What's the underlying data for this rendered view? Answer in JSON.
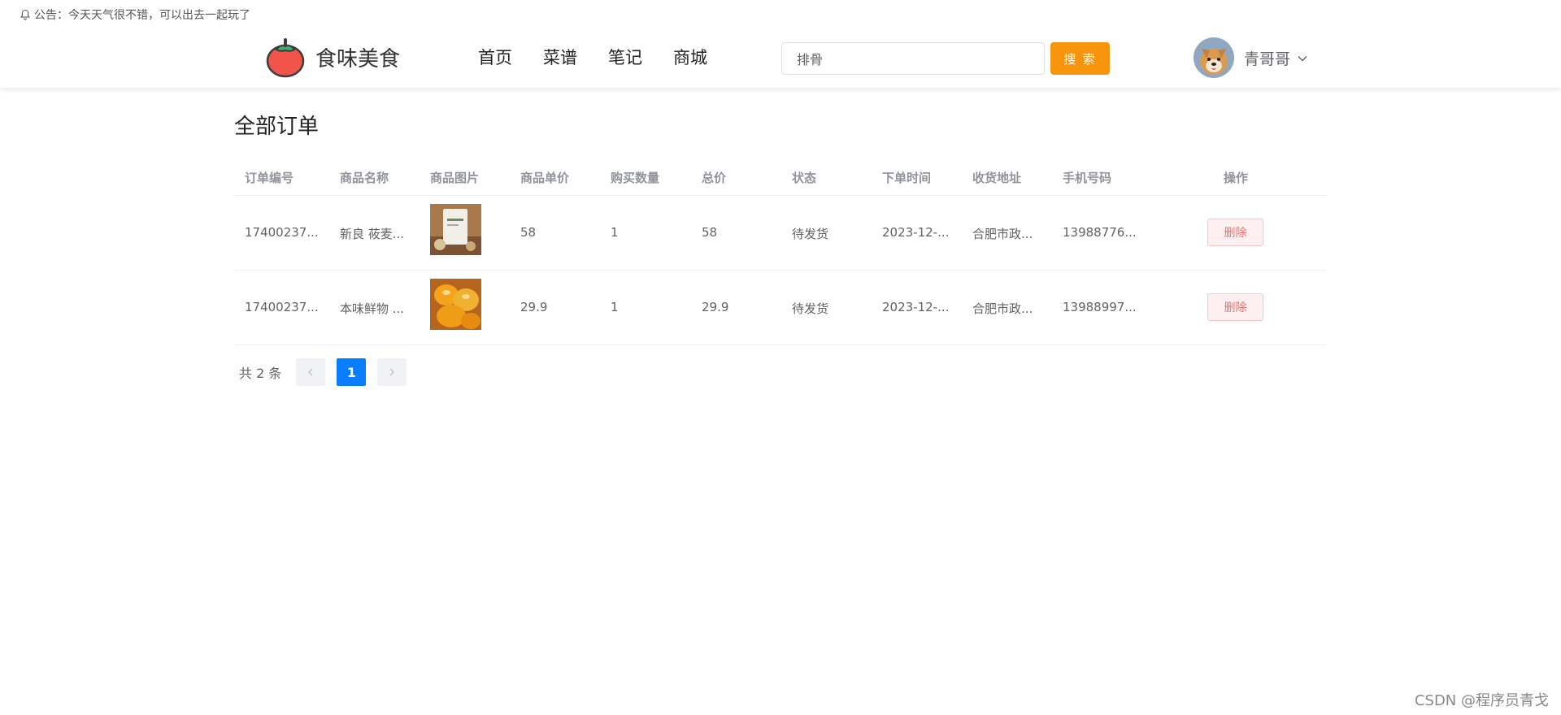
{
  "notice": {
    "text": "公告：今天天气很不错，可以出去一起玩了"
  },
  "header": {
    "brand": "食味美食",
    "nav": [
      "首页",
      "菜谱",
      "笔记",
      "商城"
    ],
    "search_value": "排骨",
    "search_button": "搜 索",
    "username": "青哥哥"
  },
  "page": {
    "title": "全部订单"
  },
  "table": {
    "columns": [
      "订单编号",
      "商品名称",
      "商品图片",
      "商品单价",
      "购买数量",
      "总价",
      "状态",
      "下单时间",
      "收货地址",
      "手机号码",
      "操作"
    ],
    "rows": [
      {
        "order_no": "17400237...",
        "name": "新良 莜麦...",
        "price": "58",
        "qty": "1",
        "total": "58",
        "status": "待发货",
        "time": "2023-12-...",
        "address": "合肥市政...",
        "phone": "13988776...",
        "action": "删除"
      },
      {
        "order_no": "17400237...",
        "name": "本味鲜物 ...",
        "price": "29.9",
        "qty": "1",
        "total": "29.9",
        "status": "待发货",
        "time": "2023-12-...",
        "address": "合肥市政...",
        "phone": "13988997...",
        "action": "删除"
      }
    ]
  },
  "pagination": {
    "total_text": "共 2 条",
    "current_page": "1"
  },
  "watermark": "CSDN @程序员青戈",
  "colors": {
    "accent": "#f7940e",
    "primary": "#0a7cff",
    "danger": "#f56c6c"
  }
}
